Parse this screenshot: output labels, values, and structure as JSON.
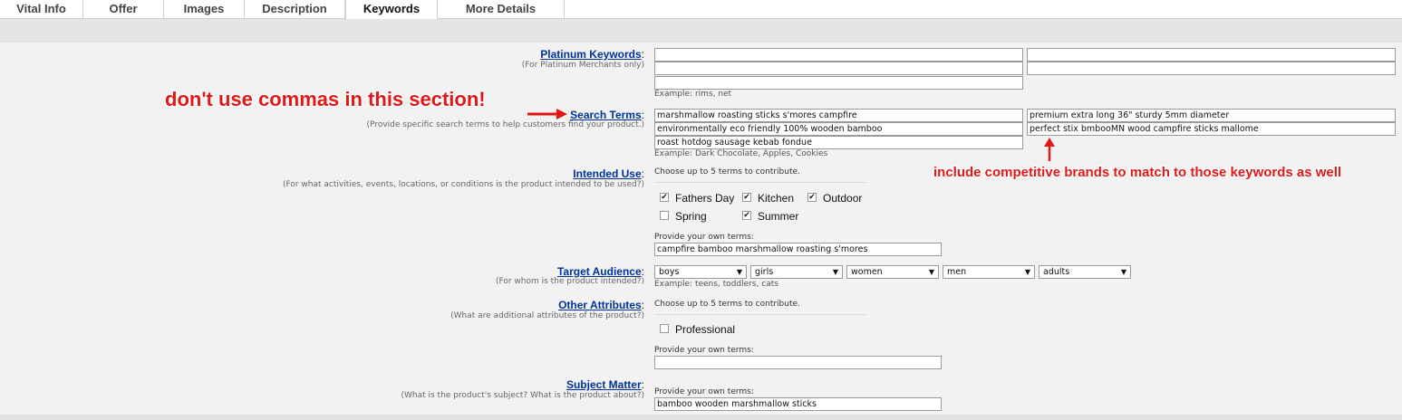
{
  "tabs": [
    "Vital Info",
    "Offer",
    "Images",
    "Description",
    "Keywords",
    "More Details"
  ],
  "platinum": {
    "label": "Platinum Keywords",
    "hint": "(For Platinum Merchants only)",
    "example": "Example:  rims, net",
    "values": [
      "",
      "",
      "",
      "",
      ""
    ]
  },
  "search_terms": {
    "label": "Search Terms",
    "hint": "(Provide specific search terms to help customers find your product.)",
    "values": [
      "marshmallow roasting sticks s'mores campfire",
      "premium extra long 36\" sturdy 5mm diameter",
      "environmentally eco friendly 100% wooden bamboo",
      "perfect stix bmbooMN wood campfire sticks mallome",
      "roast hotdog sausage kebab fondue"
    ],
    "example": "Example:  Dark Chocolate, Apples, Cookies"
  },
  "intended_use": {
    "label": "Intended Use",
    "hint": "(For what activities, events, locations, or conditions is the product intended to be used?)",
    "choose_text": "Choose up to 5 terms to contribute.",
    "options": [
      {
        "label": "Fathers Day",
        "checked": true
      },
      {
        "label": "Kitchen",
        "checked": true
      },
      {
        "label": "Outdoor",
        "checked": true
      },
      {
        "label": "Spring",
        "checked": false
      },
      {
        "label": "Summer",
        "checked": true
      }
    ],
    "own_terms_label": "Provide your own terms:",
    "own_terms_value": "campfire bamboo marshmallow roasting s'mores"
  },
  "target_audience": {
    "label": "Target Audience",
    "hint": "(For whom is the product intended?)",
    "selects": [
      "boys",
      "girls",
      "women",
      "men",
      "adults"
    ],
    "example": "Example:  teens, toddlers, cats"
  },
  "other_attributes": {
    "label": "Other Attributes",
    "hint": "(What are additional attributes of the product?)",
    "choose_text": "Choose up to 5 terms to contribute.",
    "options": [
      {
        "label": "Professional",
        "checked": false
      }
    ],
    "own_terms_label": "Provide your own terms:",
    "own_terms_value": ""
  },
  "subject_matter": {
    "label": "Subject Matter",
    "hint": "(What is the product's subject? What is the product about?)",
    "own_terms_label": "Provide your own terms:",
    "own_terms_value": "bamboo wooden marshmallow sticks"
  },
  "colon": ":",
  "check_mark": "✔",
  "dropdown_arrow": "▼",
  "annotations": {
    "left_note": "don't use commas in this section!",
    "right_note": "include competitive brands to match to those keywords as well",
    "color": "#e01818"
  }
}
